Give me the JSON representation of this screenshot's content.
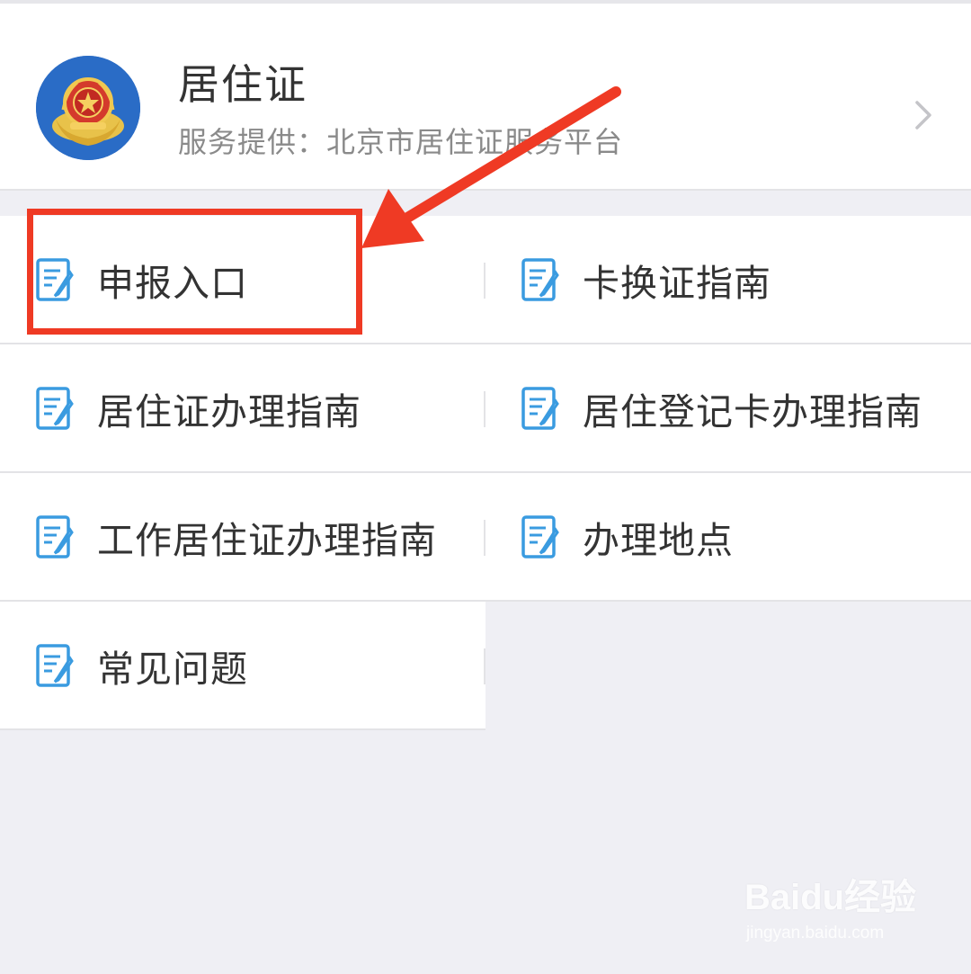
{
  "header": {
    "title": "居住证",
    "provider": "服务提供：北京市居住证服务平台",
    "logo_icon": "police-emblem-icon",
    "chevron_icon": "chevron-right-icon"
  },
  "menu": {
    "items": [
      {
        "label": "申报入口",
        "icon": "document-edit-icon"
      },
      {
        "label": "卡换证指南",
        "icon": "document-edit-icon"
      },
      {
        "label": "居住证办理指南",
        "icon": "document-edit-icon"
      },
      {
        "label": "居住登记卡办理指南",
        "icon": "document-edit-icon"
      },
      {
        "label": "工作居住证办理指南",
        "icon": "document-edit-icon"
      },
      {
        "label": "办理地点",
        "icon": "document-edit-icon"
      },
      {
        "label": "常见问题",
        "icon": "document-edit-icon"
      }
    ]
  },
  "annotation": {
    "highlight_color": "#ef3a24",
    "target": "申报入口"
  },
  "watermark": {
    "brand": "Baidu经验",
    "url": "jingyan.baidu.com"
  },
  "colors": {
    "icon_blue": "#3a9be0",
    "background": "#efeff4",
    "text": "#333333",
    "subtext": "#8a8a8a"
  }
}
